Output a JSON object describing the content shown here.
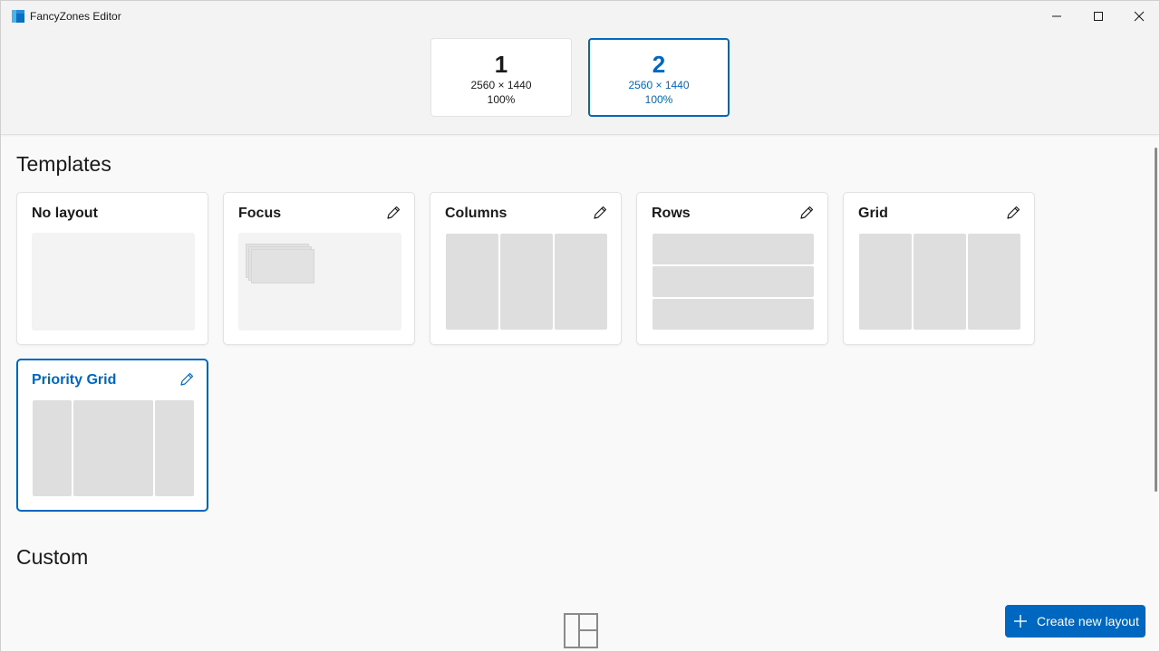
{
  "window": {
    "title": "FancyZones Editor"
  },
  "monitors": [
    {
      "number": "1",
      "resolution": "2560 × 1440",
      "scale": "100%"
    },
    {
      "number": "2",
      "resolution": "2560 × 1440",
      "scale": "100%"
    }
  ],
  "templates": {
    "heading": "Templates",
    "items": [
      {
        "name": "No layout",
        "icon": "pencil-icon"
      },
      {
        "name": "Focus",
        "icon": "pencil-icon"
      },
      {
        "name": "Columns",
        "icon": "pencil-icon"
      },
      {
        "name": "Rows",
        "icon": "pencil-icon"
      },
      {
        "name": "Grid",
        "icon": "pencil-icon"
      },
      {
        "name": "Priority Grid",
        "icon": "pencil-icon"
      }
    ]
  },
  "custom": {
    "heading": "Custom"
  },
  "actions": {
    "create_label": "Create new layout"
  },
  "colors": {
    "accent": "#0067c0",
    "zone": "#dedede",
    "preview_bg": "#f3f3f3"
  }
}
